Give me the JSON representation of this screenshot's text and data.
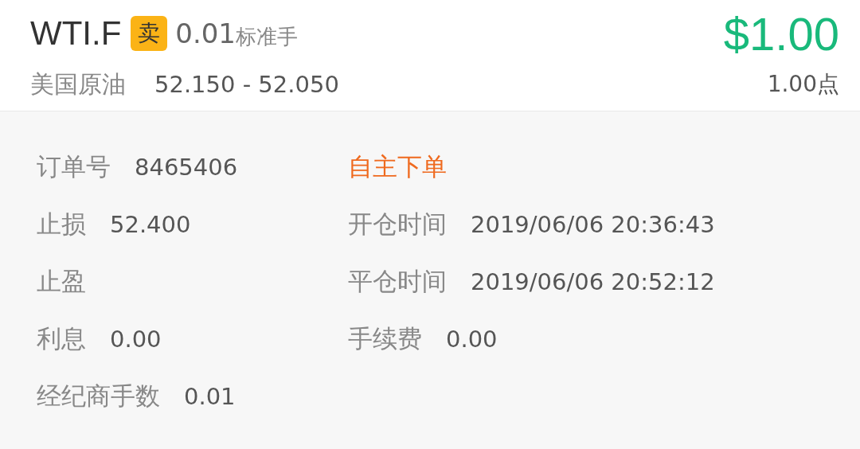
{
  "header": {
    "symbol": "WTI.F",
    "side": "卖",
    "lots": "0.01",
    "lot_unit": "标准手",
    "name": "美国原油",
    "price_range": "52.150 - 52.050",
    "profit": "$1.00",
    "points": "1.00点"
  },
  "details": [
    {
      "kind": "field",
      "label": "订单号",
      "value": "8465406"
    },
    {
      "kind": "tag",
      "text": "自主下单"
    },
    {
      "kind": "field",
      "label": "止损",
      "value": "52.400"
    },
    {
      "kind": "field",
      "label": "开仓时间",
      "value": "2019/06/06 20:36:43"
    },
    {
      "kind": "field",
      "label": "止盈"
    },
    {
      "kind": "field",
      "label": "平仓时间",
      "value": "2019/06/06 20:52:12"
    },
    {
      "kind": "field",
      "label": "利息",
      "value": "0.00"
    },
    {
      "kind": "field",
      "label": "手续费",
      "value": "0.00"
    },
    {
      "kind": "field",
      "label": "经纪商手数",
      "value": "0.01"
    }
  ]
}
